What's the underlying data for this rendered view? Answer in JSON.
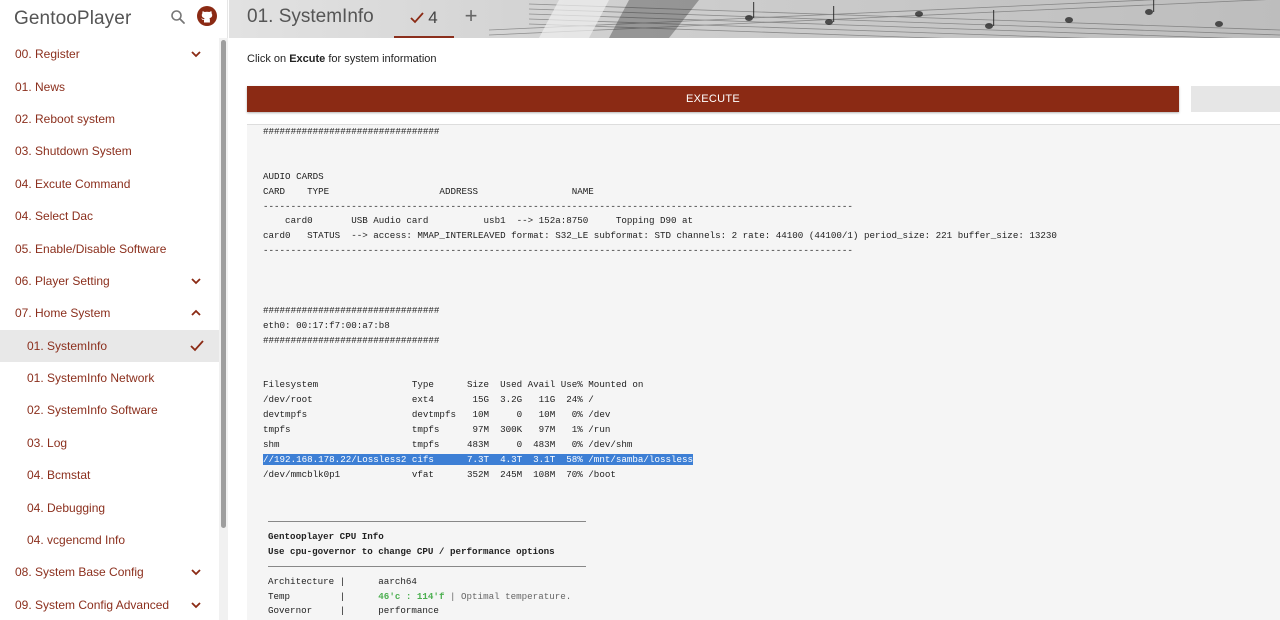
{
  "sidebar": {
    "app_title": "GentooPlayer",
    "items": [
      {
        "label": "00. Register",
        "chevron": "down"
      },
      {
        "label": "01. News"
      },
      {
        "label": "02. Reboot system"
      },
      {
        "label": "03. Shutdown System"
      },
      {
        "label": "04. Excute Command"
      },
      {
        "label": "04. Select Dac"
      },
      {
        "label": "05. Enable/Disable Software"
      },
      {
        "label": "06. Player Setting",
        "chevron": "down"
      },
      {
        "label": "07. Home System",
        "chevron": "up"
      },
      {
        "label": "01. SystemInfo",
        "active": true
      },
      {
        "label": "01. SystemInfo Network"
      },
      {
        "label": "02. SystemInfo Software"
      },
      {
        "label": "03. Log"
      },
      {
        "label": "04. Bcmstat"
      },
      {
        "label": "04. Debugging"
      },
      {
        "label": "04. vcgencmd Info"
      },
      {
        "label": "08. System Base Config",
        "chevron": "down"
      },
      {
        "label": "09. System Config Advanced",
        "chevron": "down"
      }
    ]
  },
  "header": {
    "tab_title": "01. SystemInfo",
    "tab_count": "4",
    "add_tab": "+"
  },
  "main": {
    "hint_prefix": "Click on ",
    "hint_bold": "Excute",
    "hint_suffix": " for system information",
    "execute_label": "EXECUTE",
    "output": {
      "line_hash1": "################################",
      "audio_title": "AUDIO CARDS",
      "audio_header": "CARD    TYPE                    ADDRESS                 NAME",
      "dash1": "-----------------------------------------------------------------------------------------------------------",
      "card_line": "    card0       USB Audio card          usb1  --> 152a:8750     Topping D90 at",
      "status_line": "card0   STATUS  --> access: MMAP_INTERLEAVED format: S32_LE subformat: STD channels: 2 rate: 44100 (44100/1) period_size: 221 buffer_size: 13230",
      "dash2": "-----------------------------------------------------------------------------------------------------------",
      "hash2": "################################",
      "eth_line": "eth0: 00:17:f7:00:a7:b8",
      "hash3": "################################",
      "fs_header": "Filesystem                 Type      Size  Used Avail Use% Mounted on",
      "fs_rows": [
        "/dev/root                  ext4       15G  3.2G   11G  24% /",
        "devtmpfs                   devtmpfs   10M     0   10M   0% /dev",
        "tmpfs                      tmpfs      97M  300K   97M   1% /run",
        "shm                        tmpfs     483M     0  483M   0% /dev/shm"
      ],
      "fs_highlight": "//192.168.178.22/Lossless2 cifs      7.3T  4.3T  3.1T  58% /mnt/samba/lossless",
      "fs_last": "/dev/mmcblk0p1             vfat      352M  245M  108M  70% /boot",
      "cpu_title": "Gentooplayer CPU Info",
      "cpu_subtitle": "Use cpu-governor to change CPU / performance options",
      "arch_label": "Architecture |",
      "arch_value": "aarch64",
      "temp_label": "Temp         |",
      "temp_value": "46'c : 114'f",
      "temp_note": " | Optimal temperature.",
      "gov_label": "Governor     |",
      "gov_value": "performance"
    }
  }
}
